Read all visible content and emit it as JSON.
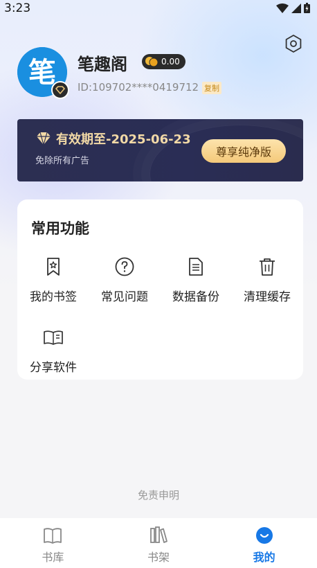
{
  "status_bar": {
    "time": "3:23"
  },
  "profile": {
    "username": "笔趣阁",
    "coins": "0.00",
    "user_id": "ID:109702****0419712",
    "copy_label": "复制",
    "avatar_char": "笔"
  },
  "vip": {
    "expire_text": "有效期至-2025-06-23",
    "subtitle": "免除所有广告",
    "button_label": "尊享纯净版"
  },
  "functions": {
    "title": "常用功能",
    "items": [
      {
        "label": "我的书签",
        "icon": "bookmark-icon"
      },
      {
        "label": "常见问题",
        "icon": "question-icon"
      },
      {
        "label": "数据备份",
        "icon": "document-icon"
      },
      {
        "label": "清理缓存",
        "icon": "trash-icon"
      },
      {
        "label": "分享软件",
        "icon": "open-book-icon"
      }
    ]
  },
  "disclaimer": "免责申明",
  "bottom_nav": {
    "items": [
      {
        "label": "书库",
        "icon": "book-icon",
        "active": false
      },
      {
        "label": "书架",
        "icon": "bookshelf-icon",
        "active": false
      },
      {
        "label": "我的",
        "icon": "profile-icon",
        "active": true
      }
    ]
  },
  "colors": {
    "accent": "#1778e6",
    "vip_gold": "#f2d9a6",
    "vip_bg": "#2c2f52"
  }
}
